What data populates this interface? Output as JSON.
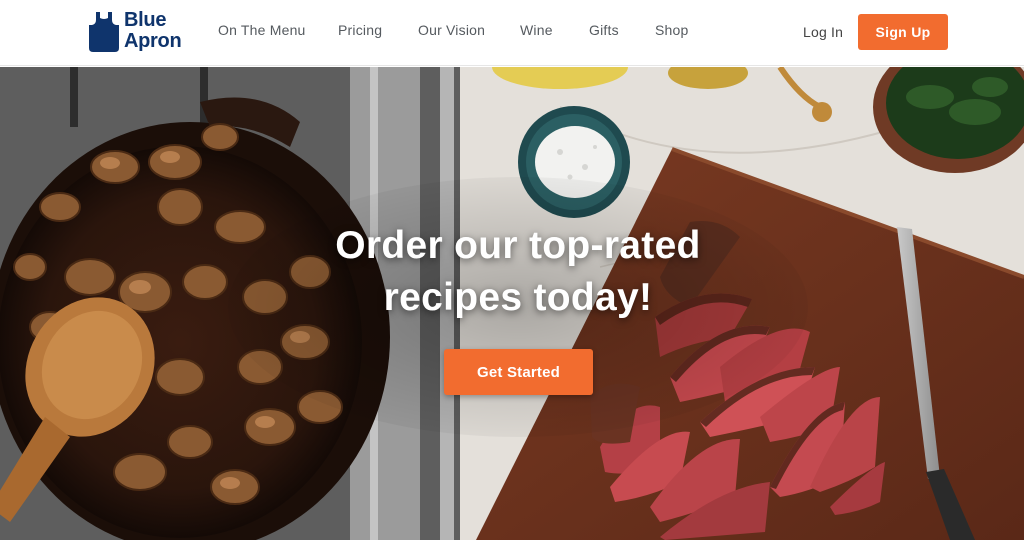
{
  "brand": {
    "line1": "Blue",
    "line2": "Apron",
    "logo_icon": "apron-icon",
    "color": "#0f346c"
  },
  "nav": {
    "items": [
      {
        "label": "On The Menu"
      },
      {
        "label": "Pricing"
      },
      {
        "label": "Our Vision"
      },
      {
        "label": "Wine"
      },
      {
        "label": "Gifts"
      },
      {
        "label": "Shop"
      }
    ],
    "login_label": "Log In",
    "signup_label": "Sign Up"
  },
  "hero": {
    "title_line1": "Order our top-rated",
    "title_line2": "recipes today!",
    "cta_label": "Get Started",
    "image_description_icon": "food-photo"
  },
  "colors": {
    "accent": "#f26c2f",
    "brand_blue": "#0f346c",
    "nav_text": "#555a5f"
  }
}
